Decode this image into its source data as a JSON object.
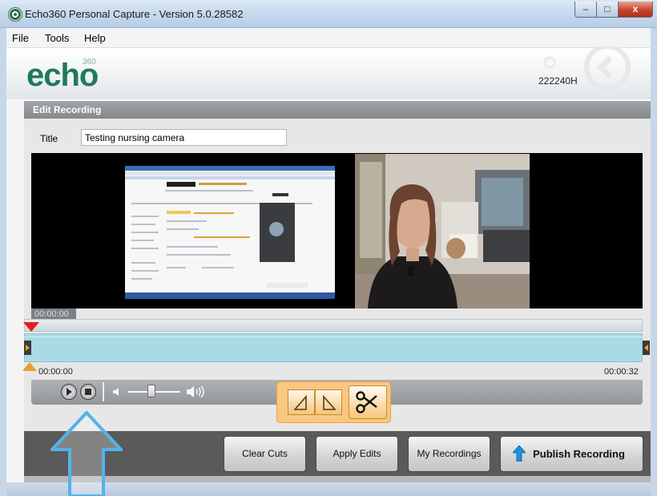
{
  "window": {
    "title": "Echo360 Personal Capture - Version 5.0.28582",
    "min_glyph": "–",
    "max_glyph": "□",
    "close_glyph": "x"
  },
  "menu": {
    "items": [
      "File",
      "Tools",
      "Help"
    ]
  },
  "header": {
    "logo": "echo",
    "logo_super": "360",
    "device_id": "222240H"
  },
  "panel": {
    "heading": "Edit Recording",
    "title_label": "Title",
    "title_value": "Testing nursing camera"
  },
  "timeline": {
    "current_time": "00:00:00",
    "start_time": "00:00:00",
    "end_time": "00:00:32"
  },
  "buttons": {
    "clear_cuts": "Clear Cuts",
    "apply_edits": "Apply Edits",
    "my_recordings": "My Recordings",
    "publish": "Publish Recording"
  },
  "colors": {
    "accent_green": "#1f7a5a",
    "timeline_blue": "#a9dbe6",
    "playhead_red": "#e21f1f",
    "tool_orange": "#f9c77f",
    "annotation_blue": "#53b4e8"
  },
  "icons": [
    "app-icon",
    "play-icon",
    "stop-icon",
    "mute-icon",
    "speaker-icon",
    "mark-in-icon",
    "mark-out-icon",
    "scissors-icon",
    "upload-arrow-icon"
  ]
}
